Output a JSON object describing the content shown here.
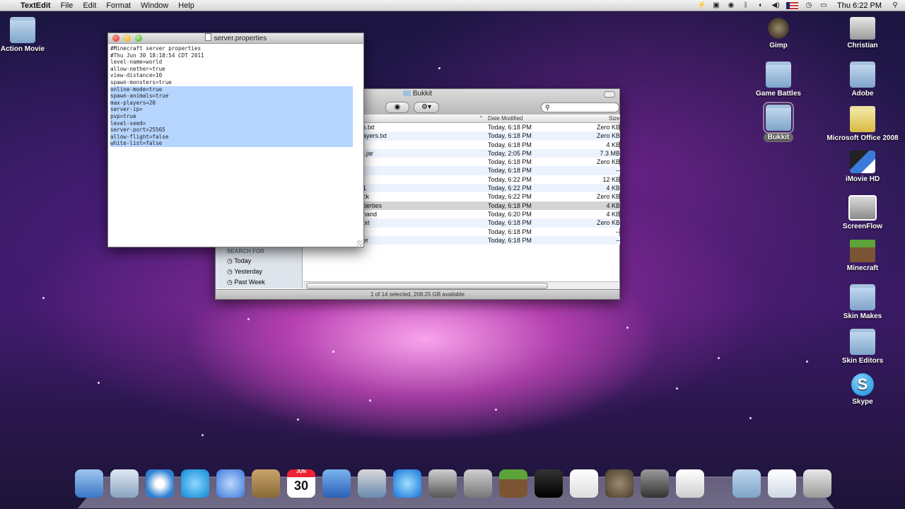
{
  "menubar": {
    "app_name": "TextEdit",
    "menus": [
      "File",
      "Edit",
      "Format",
      "Window",
      "Help"
    ],
    "clock": "Thu 6:22 PM"
  },
  "desktop_icons": [
    {
      "label": "Action Movie"
    },
    {
      "label": "Gimp"
    },
    {
      "label": "Christian"
    },
    {
      "label": "Game Battles"
    },
    {
      "label": "Adobe"
    },
    {
      "label": "Bukkit"
    },
    {
      "label": "Microsoft Office 2008"
    },
    {
      "label": "iMovie HD"
    },
    {
      "label": "ScreenFlow"
    },
    {
      "label": "Minecraft"
    },
    {
      "label": "Skin Makes"
    },
    {
      "label": "Skin Editors"
    },
    {
      "label": "Skype"
    }
  ],
  "textedit": {
    "title": "server.properties",
    "lines": [
      "#Minecraft server properties",
      "#Thu Jun 30 18:18:54 CDT 2011",
      "level-name=world",
      "allow-nether=true",
      "view-distance=10",
      "spawn-monsters=true",
      "online-mode=true",
      "spawn-animals=true",
      "max-players=20",
      "server-ip=",
      "pvp=true",
      "level-seed=",
      "server-port=25565",
      "allow-flight=false",
      "white-list=false"
    ],
    "selected_from": 6
  },
  "finder": {
    "title": "Bukkit",
    "columns": {
      "date": "Date Modified",
      "size": "Size"
    },
    "rows": [
      {
        "name": "s.txt",
        "date": "Today, 6:18 PM",
        "size": "Zero KB"
      },
      {
        "name": "ayers.txt",
        "date": "Today, 6:18 PM",
        "size": "Zero KB"
      },
      {
        "name": "",
        "date": "Today, 6:18 PM",
        "size": "4 KB"
      },
      {
        "name": "t.jar",
        "date": "Today, 2:05 PM",
        "size": "7.3 MB"
      },
      {
        "name": "",
        "date": "Today, 6:18 PM",
        "size": "Zero KB"
      },
      {
        "name": "",
        "date": "Today, 6:18 PM",
        "size": "--"
      },
      {
        "name": "",
        "date": "Today, 6:22 PM",
        "size": "12 KB"
      },
      {
        "name": "1",
        "date": "Today, 6:22 PM",
        "size": "4 KB"
      },
      {
        "name": "ck",
        "date": "Today, 6:22 PM",
        "size": "Zero KB"
      },
      {
        "name": "perties",
        "date": "Today, 6:18 PM",
        "size": "4 KB"
      },
      {
        "name": "hand",
        "date": "Today, 6:20 PM",
        "size": "4 KB"
      },
      {
        "name": "txt",
        "date": "Today, 6:18 PM",
        "size": "Zero KB"
      },
      {
        "name": "",
        "date": "Today, 6:18 PM",
        "size": "--"
      },
      {
        "name": "er",
        "date": "Today, 6:18 PM",
        "size": "--"
      }
    ],
    "highlighted_row": 9,
    "sidebar": {
      "section": "SEARCH FOR",
      "items": [
        "Today",
        "Yesterday",
        "Past Week"
      ]
    },
    "status": "1 of 14 selected, 208.25 GB available"
  },
  "dock": {
    "items": [
      "finder-icon",
      "mail-icon",
      "safari-icon",
      "skype-icon",
      "ichat-icon",
      "address-book-icon",
      "ical-icon",
      "word-icon",
      "iphoto-icon",
      "itunes-icon",
      "spaces-icon",
      "system-preferences-icon",
      "minecraft-icon",
      "terminal-icon",
      "textedit-icon",
      "gimp-icon",
      "screenflow-icon",
      "preview-icon",
      "applications-folder-icon",
      "documents-stack-icon",
      "trash-icon"
    ],
    "calendar_month": "JUN",
    "calendar_day": "30"
  },
  "colors": {
    "selection": "#b5d5ff",
    "finder_stripe": "#edf3fe"
  }
}
